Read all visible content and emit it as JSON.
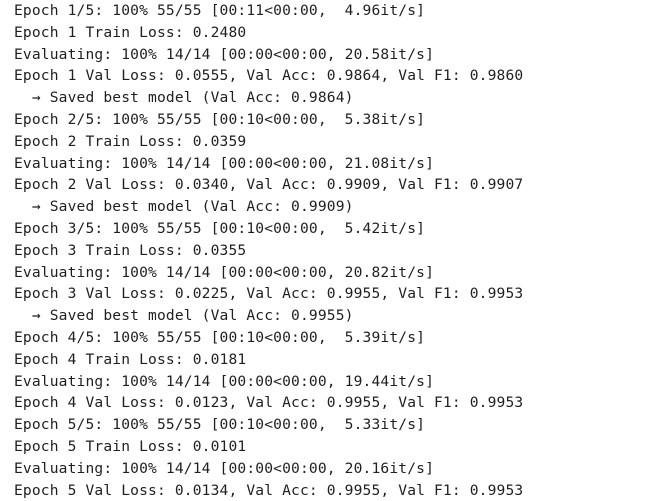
{
  "output_lines": [
    "Epoch 1/5: 100% 55/55 [00:11<00:00,  4.96it/s]",
    "Epoch 1 Train Loss: 0.2480",
    "Evaluating: 100% 14/14 [00:00<00:00, 20.58it/s]",
    "Epoch 1 Val Loss: 0.0555, Val Acc: 0.9864, Val F1: 0.9860",
    "  → Saved best model (Val Acc: 0.9864)",
    "Epoch 2/5: 100% 55/55 [00:10<00:00,  5.38it/s]",
    "Epoch 2 Train Loss: 0.0359",
    "Evaluating: 100% 14/14 [00:00<00:00, 21.08it/s]",
    "Epoch 2 Val Loss: 0.0340, Val Acc: 0.9909, Val F1: 0.9907",
    "  → Saved best model (Val Acc: 0.9909)",
    "Epoch 3/5: 100% 55/55 [00:10<00:00,  5.42it/s]",
    "Epoch 3 Train Loss: 0.0355",
    "Evaluating: 100% 14/14 [00:00<00:00, 20.82it/s]",
    "Epoch 3 Val Loss: 0.0225, Val Acc: 0.9955, Val F1: 0.9953",
    "  → Saved best model (Val Acc: 0.9955)",
    "Epoch 4/5: 100% 55/55 [00:10<00:00,  5.39it/s]",
    "Epoch 4 Train Loss: 0.0181",
    "Evaluating: 100% 14/14 [00:00<00:00, 19.44it/s]",
    "Epoch 4 Val Loss: 0.0123, Val Acc: 0.9955, Val F1: 0.9953",
    "Epoch 5/5: 100% 55/55 [00:10<00:00,  5.33it/s]",
    "Epoch 5 Train Loss: 0.0101",
    "Evaluating: 100% 14/14 [00:00<00:00, 20.16it/s]",
    "Epoch 5 Val Loss: 0.0134, Val Acc: 0.9955, Val F1: 0.9953"
  ]
}
